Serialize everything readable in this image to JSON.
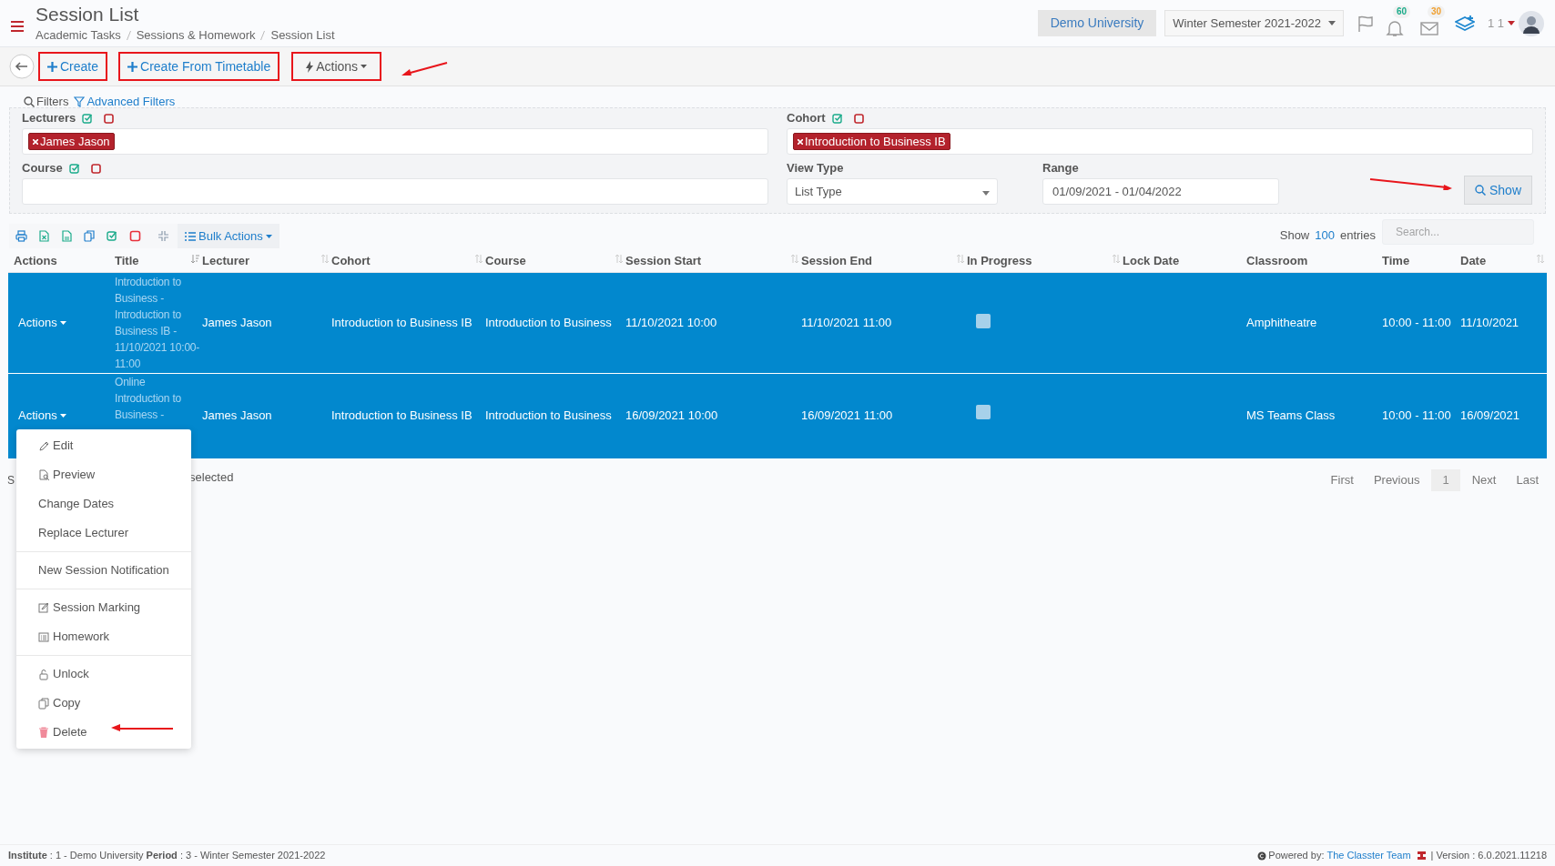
{
  "header": {
    "title": "Session List",
    "breadcrumb": [
      "Academic Tasks",
      "Sessions & Homework",
      "Session List"
    ],
    "institution": "Demo University",
    "period": "Winter Semester 2021-2022",
    "notifications_badge": "60",
    "messages_badge": "30",
    "user_label": "1 1"
  },
  "toolbar": {
    "buttons": [
      {
        "label": "Create",
        "kind": "plus"
      },
      {
        "label": "Create From Timetable",
        "kind": "plus"
      },
      {
        "label": "Actions",
        "kind": "bolt"
      }
    ]
  },
  "filters": {
    "label": "Filters",
    "advanced_link": "Advanced Filters",
    "lecturers": {
      "label": "Lecturers",
      "tags": [
        "James Jason"
      ]
    },
    "cohort": {
      "label": "Cohort",
      "tags": [
        "Introduction to Business IB"
      ]
    },
    "course": {
      "label": "Course"
    },
    "view_type": {
      "label": "View Type",
      "value": "List Type"
    },
    "range": {
      "label": "Range",
      "value": "01/09/2021 - 01/04/2022"
    },
    "show_button": "Show"
  },
  "table_toolbar": {
    "bulk_actions": "Bulk Actions",
    "show_label": "Show",
    "page_size": "100",
    "entries_label": "entries",
    "search_placeholder": "Search..."
  },
  "table": {
    "columns": [
      {
        "label": "Actions",
        "sortable": false,
        "sorted": false
      },
      {
        "label": "Title",
        "sortable": true,
        "sorted": true
      },
      {
        "label": "Lecturer",
        "sortable": true,
        "sorted": false
      },
      {
        "label": "Cohort",
        "sortable": true,
        "sorted": false
      },
      {
        "label": "Course",
        "sortable": true,
        "sorted": false
      },
      {
        "label": "Session Start",
        "sortable": true,
        "sorted": false
      },
      {
        "label": "Session End",
        "sortable": true,
        "sorted": false
      },
      {
        "label": "In Progress",
        "sortable": true,
        "sorted": false
      },
      {
        "label": "Lock Date",
        "sortable": false,
        "sorted": false
      },
      {
        "label": "Classroom",
        "sortable": false,
        "sorted": false
      },
      {
        "label": "Time",
        "sortable": false,
        "sorted": false
      },
      {
        "label": "Date",
        "sortable": true,
        "sorted": false
      }
    ],
    "rows": [
      {
        "selected": true,
        "actions": "Actions",
        "title": "Introduction to Business - Introduction to Business IB - 11/10/2021 10:00-11:00",
        "lecturer": "James Jason",
        "cohort": "Introduction to Business IB",
        "course": "Introduction to Business",
        "session_start": "11/10/2021 10:00",
        "session_end": "11/10/2021 11:00",
        "in_progress": false,
        "classroom": "Amphitheatre",
        "time": "10:00 - 11:00",
        "date": "11/10/2021"
      },
      {
        "selected": true,
        "actions": "Actions",
        "title": "Online Introduction to Business -",
        "lecturer": "James Jason",
        "cohort": "Introduction to Business IB",
        "course": "Introduction to Business",
        "session_start": "16/09/2021 10:00",
        "session_end": "16/09/2021 11:00",
        "in_progress": false,
        "classroom": "MS Teams Class",
        "time": "10:00 - 11:00",
        "date": "16/09/2021"
      }
    ]
  },
  "status": {
    "left": "S",
    "right": "selected"
  },
  "pagination": [
    {
      "label": "First",
      "selected": false
    },
    {
      "label": "Previous",
      "selected": false
    },
    {
      "label": "1",
      "selected": true
    },
    {
      "label": "Next",
      "selected": false
    },
    {
      "label": "Last",
      "selected": false
    }
  ],
  "actions_menu": [
    [
      {
        "label": "Edit",
        "kind": "pencil"
      },
      {
        "label": "Preview",
        "kind": "preview"
      },
      {
        "label": "Change Dates",
        "kind": "plain"
      },
      {
        "label": "Replace Lecturer",
        "kind": "plain"
      }
    ],
    [
      {
        "label": "New Session Notification",
        "kind": "plain"
      }
    ],
    [
      {
        "label": "Session Marking",
        "kind": "marking"
      },
      {
        "label": "Homework",
        "kind": "list"
      }
    ],
    [
      {
        "label": "Unlock",
        "kind": "lock"
      },
      {
        "label": "Copy",
        "kind": "copy"
      },
      {
        "label": "Delete",
        "kind": "trash"
      }
    ]
  ],
  "footer": {
    "left": "**Institute** : 1 - Demo University **Period** : 3 - Winter Semester 2021-2022",
    "powered_by": "Powered by:",
    "team_link": "The Classter Team",
    "version": "| Version : 6.0.2021.11218"
  }
}
